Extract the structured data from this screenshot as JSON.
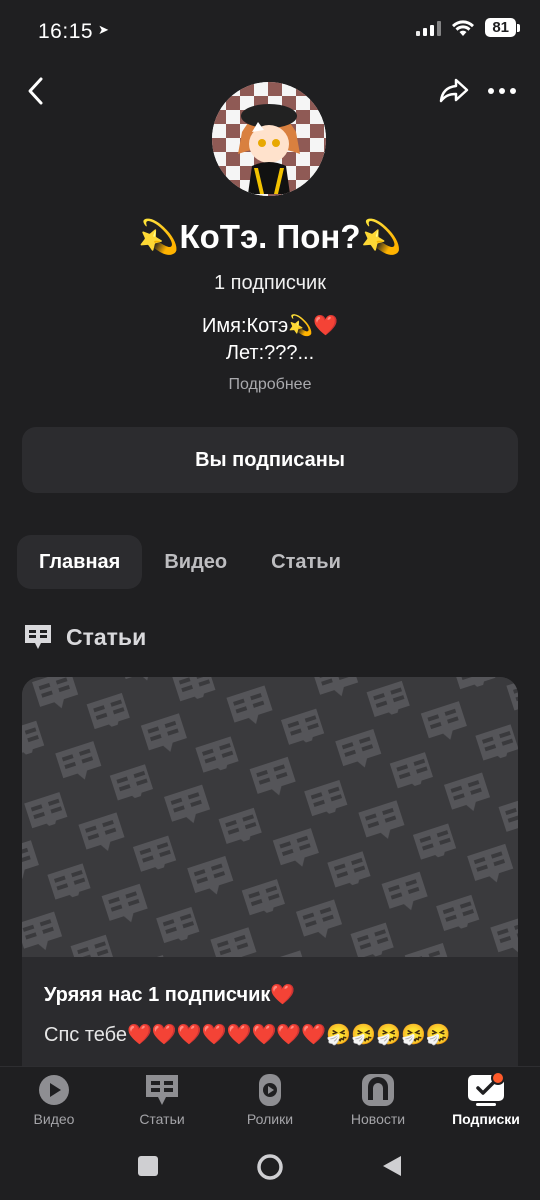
{
  "status": {
    "time": "16:15",
    "battery": "81"
  },
  "channel": {
    "title": "💫КоТэ. Пон?💫",
    "subscribers": "1 подписчик",
    "bio_line1": "Имя:Котэ💫❤️",
    "bio_line2": "Лет:???...",
    "more_label": "Подробнее",
    "subscribe_state": "Вы подписаны"
  },
  "tabs": [
    {
      "label": "Главная",
      "active": true
    },
    {
      "label": "Видео",
      "active": false
    },
    {
      "label": "Статьи",
      "active": false
    }
  ],
  "section": {
    "title": "Статьи",
    "icon": "article-book-icon"
  },
  "article": {
    "title": "Уряяя нас 1 подписчик❤️",
    "text": "Спс тебе❤️❤️❤️❤️❤️❤️❤️❤️🤧🤧🤧🤧🤧"
  },
  "bottom_nav": [
    {
      "label": "Видео",
      "icon": "play-icon"
    },
    {
      "label": "Статьи",
      "icon": "article-icon"
    },
    {
      "label": "Ролики",
      "icon": "shorts-icon"
    },
    {
      "label": "Новости",
      "icon": "news-icon"
    },
    {
      "label": "Подписки",
      "icon": "subscriptions-icon",
      "active": true
    }
  ],
  "colors": {
    "background": "#1f1f21",
    "surface": "#2c2c2f",
    "accent_dot": "#ff5a2a"
  }
}
